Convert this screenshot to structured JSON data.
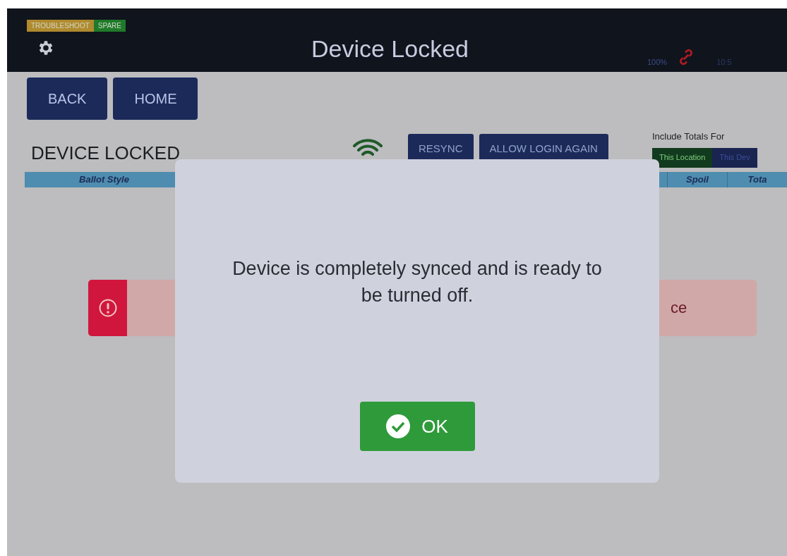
{
  "header": {
    "tags": [
      {
        "label": "TROUBLESHOOT",
        "color": "#b08a2e"
      },
      {
        "label": "SPARE",
        "color": "#1f7a2a"
      }
    ],
    "title": "Device Locked",
    "battery": "100%",
    "time": "10:5"
  },
  "nav": [
    "BACK",
    "HOME"
  ],
  "page": {
    "heading": "DEVICE LOCKED",
    "actions": [
      "RESYNC",
      "ALLOW LOGIN AGAIN"
    ],
    "totals": {
      "label": "Include Totals For",
      "options": [
        {
          "label": "This Location",
          "selected": true
        },
        {
          "label": "This Dev",
          "selected": false
        }
      ]
    }
  },
  "table": {
    "columns_left": [
      "Ballot Style"
    ],
    "columns_right": [
      "Spoil",
      "Tota"
    ]
  },
  "alert": {
    "text": "ce"
  },
  "dialog": {
    "message": "Device is completely synced and is ready to be turned off.",
    "button": "OK"
  }
}
